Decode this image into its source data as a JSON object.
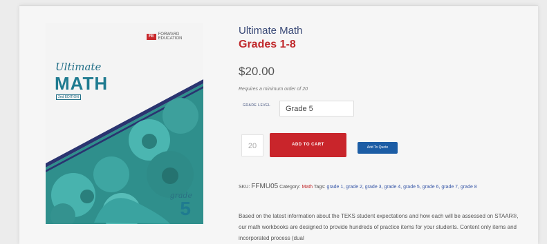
{
  "cover": {
    "publisher": "FORWARD EDUCATION",
    "publisher_logo": "FE",
    "ultimate": "Ultimate",
    "math": "MATH",
    "edition": "2nd EDITION",
    "grade_word": "grade",
    "grade_number": "5",
    "colors": {
      "teal": "#3aa3a0",
      "dark_teal": "#1f7b90",
      "navy_stripe": "#2a3470"
    }
  },
  "product": {
    "title": "Ultimate Math",
    "subtitle": "Grades 1-8",
    "price": "$20.00",
    "min_order": "Requires a minimum order of 20"
  },
  "options": {
    "grade_level_label": "GRADE LEVEL",
    "grade_level_value": "Grade 5"
  },
  "cart": {
    "quantity": "20",
    "add_to_cart": "ADD TO CART",
    "add_to_quote": "Add To Quote"
  },
  "meta": {
    "sku_label": "SKU:",
    "sku_value": "FFMU05",
    "category_label": "Category:",
    "category_value": "Math",
    "tags_label": "Tags:",
    "tags": "grade 1, grade 2, grade 3, grade 4, grade 5, grade 6, grade 7, grade 8"
  },
  "description": "Based on the latest information about the TEKS student expectations and how each will be assessed on STAAR®, our math workbooks are designed to provide hundreds of practice items for your students. Content only items and incorporated process (dual",
  "colors": {
    "accent_red": "#c9252b",
    "quote_blue": "#1c5da5",
    "title_blue": "#3a4a77"
  }
}
